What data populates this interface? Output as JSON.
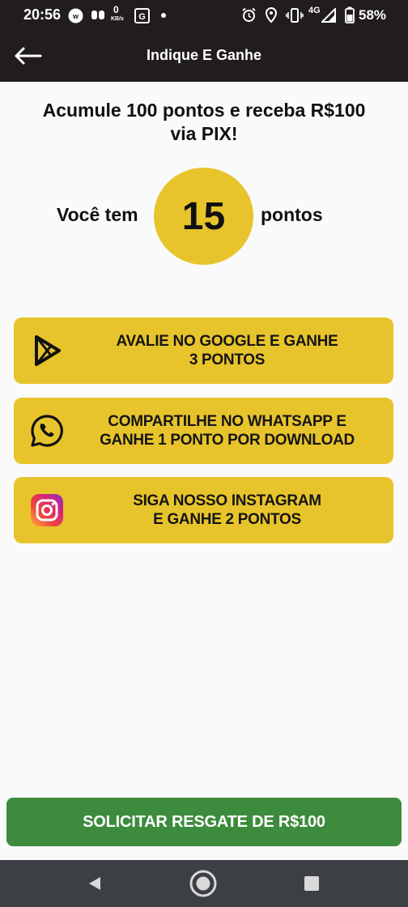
{
  "status_bar": {
    "time": "20:56",
    "network": "4G",
    "battery": "58%",
    "speed_value": "0",
    "speed_unit": "KB/s"
  },
  "app_bar": {
    "title": "Indique E Ganhe",
    "back_icon": "arrow-left-icon"
  },
  "headline": "Acumule 100 pontos e receba R$100 via PIX!",
  "points": {
    "prefix": "Você tem",
    "value": "15",
    "suffix": "pontos"
  },
  "actions": [
    {
      "icon": "google-play-icon",
      "label": "AVALIE NO GOOGLE E GANHE\n3 PONTOS"
    },
    {
      "icon": "whatsapp-icon",
      "label": "COMPARTILHE NO WHATSAPP E\nGANHE 1 PONTO POR DOWNLOAD"
    },
    {
      "icon": "instagram-icon",
      "label": "SIGA NOSSO INSTAGRAM\nE GANHE 2 PONTOS"
    }
  ],
  "redeem_button": "SOLICITAR RESGATE DE R$100",
  "colors": {
    "header": "#211d1e",
    "accent_yellow": "#e8c42c",
    "redeem_green": "#3d8b3d",
    "nav_bar": "#3c3f43"
  }
}
